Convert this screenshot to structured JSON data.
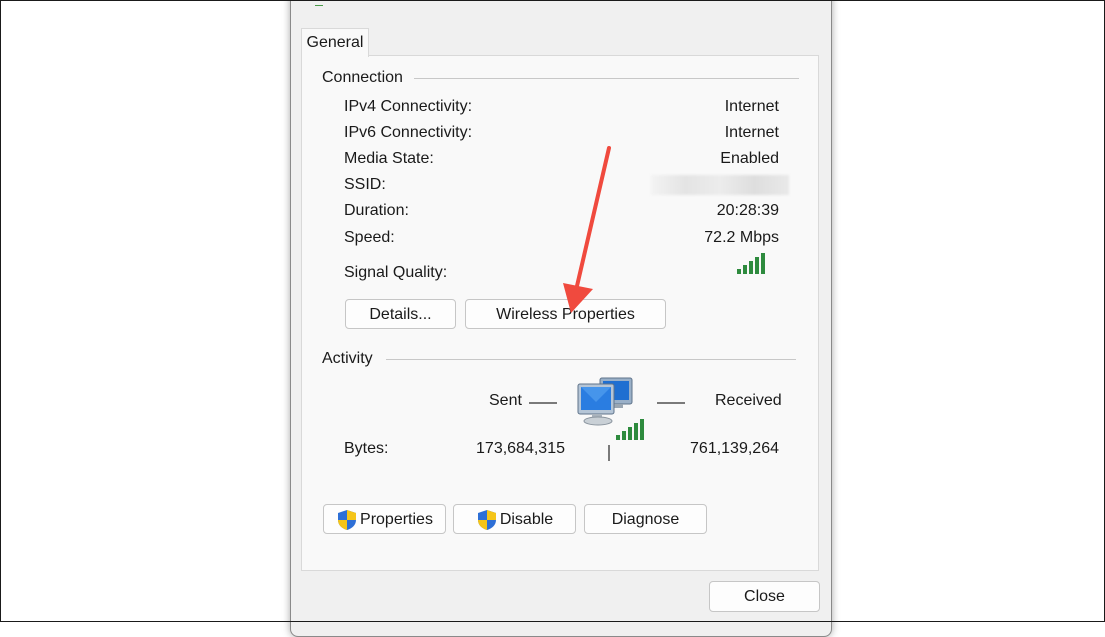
{
  "tab": {
    "label": "General"
  },
  "connection": {
    "title": "Connection",
    "rows": [
      {
        "label": "IPv4 Connectivity:",
        "value": "Internet"
      },
      {
        "label": "IPv6 Connectivity:",
        "value": "Internet"
      },
      {
        "label": "Media State:",
        "value": "Enabled"
      },
      {
        "label": "SSID:",
        "value": ""
      },
      {
        "label": "Duration:",
        "value": "20:28:39"
      },
      {
        "label": "Speed:",
        "value": "72.2 Mbps"
      }
    ],
    "signal_label": "Signal Quality:",
    "signal_bars_lit": 5,
    "signal_bars_total": 5,
    "details_button": "Details...",
    "wireless_button": "Wireless Properties"
  },
  "activity": {
    "title": "Activity",
    "sent_label": "Sent",
    "received_label": "Received",
    "bytes_label": "Bytes:",
    "bytes_sent": "173,684,315",
    "bytes_received": "761,139,264",
    "network_icon": "network-computers-icon"
  },
  "buttons": {
    "properties": "Properties",
    "disable": "Disable",
    "diagnose": "Diagnose",
    "close": "Close"
  },
  "colors": {
    "signal_green": "#2e8b3e",
    "arrow_red": "#f04a3e",
    "shield_blue": "#2d6fd6",
    "shield_yellow": "#f5c518"
  }
}
